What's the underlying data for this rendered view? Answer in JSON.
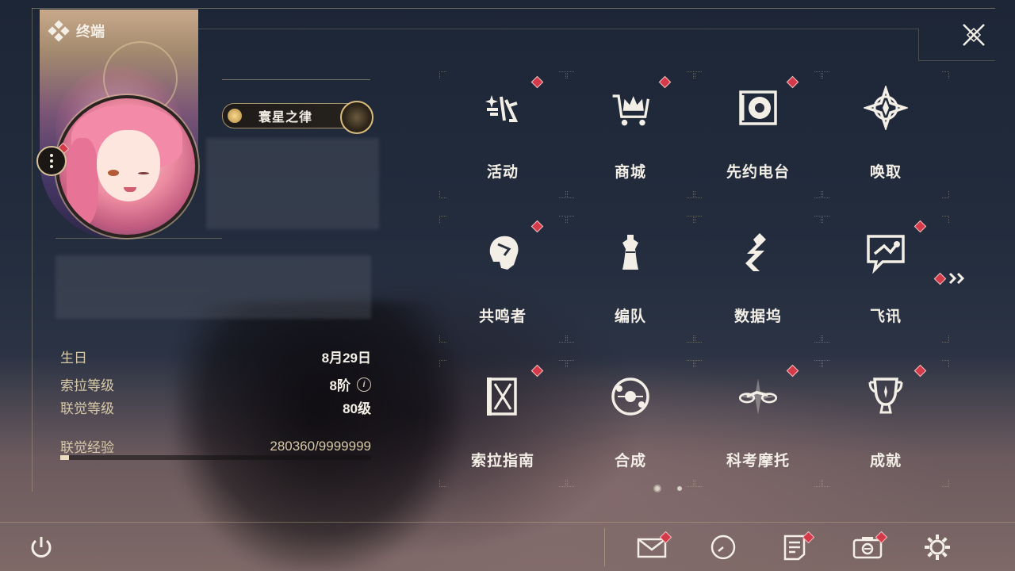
{
  "panel": {
    "title": "终端"
  },
  "profile": {
    "title_badge": "寰星之律",
    "stats": [
      {
        "label": "生日",
        "value": "8月29日"
      },
      {
        "label": "索拉等级",
        "value": "8阶"
      },
      {
        "label": "联觉等级",
        "value": "80级"
      }
    ],
    "exp": {
      "label": "联觉经验",
      "value": "280360/9999999",
      "progress": 0.028
    }
  },
  "menu": {
    "items": [
      {
        "label": "活动",
        "icon": "event-icon",
        "badge": true
      },
      {
        "label": "商城",
        "icon": "shop-crown-cart-icon",
        "badge": true
      },
      {
        "label": "先约电台",
        "icon": "radio-record-icon",
        "badge": true
      },
      {
        "label": "唤取",
        "icon": "convene-compass-icon",
        "badge": false
      },
      {
        "label": "共鸣者",
        "icon": "resonator-head-icon",
        "badge": true
      },
      {
        "label": "编队",
        "icon": "team-chess-icon",
        "badge": false
      },
      {
        "label": "数据坞",
        "icon": "data-bank-icon",
        "badge": false
      },
      {
        "label": "飞讯",
        "icon": "chat-bubble-icon",
        "badge": true
      },
      {
        "label": "索拉指南",
        "icon": "guidebook-icon",
        "badge": true
      },
      {
        "label": "合成",
        "icon": "synthesis-orb-icon",
        "badge": false
      },
      {
        "label": "科考摩托",
        "icon": "motorbike-icon",
        "badge": true
      },
      {
        "label": "成就",
        "icon": "trophy-icon",
        "badge": true
      }
    ],
    "pages": {
      "current": 1,
      "total": 2
    }
  },
  "bottom_bar": {
    "buttons": [
      {
        "name": "power-icon",
        "badge": false
      },
      {
        "name": "mail-icon",
        "badge": true
      },
      {
        "name": "clock-icon",
        "badge": false
      },
      {
        "name": "notice-icon",
        "badge": true
      },
      {
        "name": "camera-icon",
        "badge": true
      },
      {
        "name": "settings-gear-icon",
        "badge": false
      }
    ]
  },
  "colors": {
    "accent_gold": "#d6c29a",
    "badge_red": "#d43a4a",
    "text": "#f3efe6"
  }
}
